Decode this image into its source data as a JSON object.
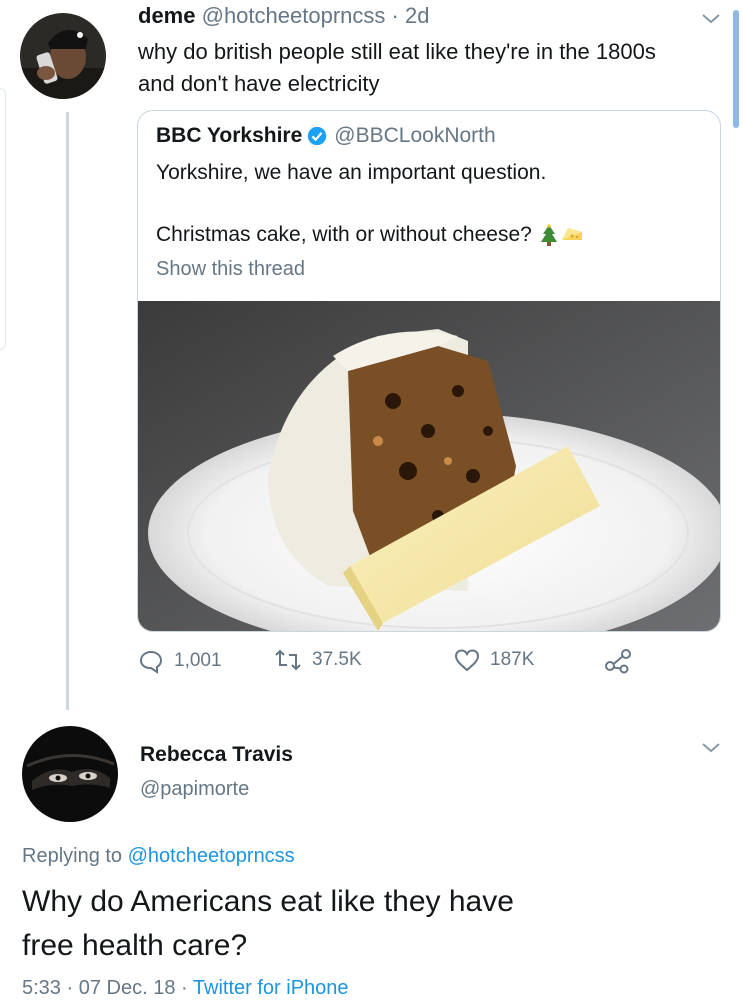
{
  "tweet": {
    "author_name": "deme",
    "author_handle": "@hotcheetoprncss",
    "separator": "·",
    "age": "2d",
    "text_line1": "why do british people still eat like they're in the 1800s",
    "text_line2": "and don't have electricity"
  },
  "quoted_tweet": {
    "author_name": "BBC Yorkshire",
    "author_handle": "@BBCLookNorth",
    "line1": "Yorkshire, we have an important question.",
    "line2": "Christmas cake, with or without cheese?",
    "emoji_1": "christmas-tree-icon",
    "emoji_2": "cheese-icon",
    "show_thread": "Show this thread",
    "image_alt": "christmas-cake-with-cheese-photo"
  },
  "actions": {
    "replies": "1,001",
    "retweets": "37.5K",
    "likes": "187K"
  },
  "reply": {
    "author_name": "Rebecca Travis",
    "author_handle": "@papimorte",
    "replying_prefix": "Replying to",
    "replying_handle": "@hotcheetoprncss",
    "text_line1": "Why do Americans eat like they have",
    "text_line2": "free health care?",
    "time": "5:33",
    "date": "07 Dec. 18",
    "source": "Twitter for iPhone"
  },
  "colors": {
    "link": "#1b95e0",
    "muted": "#657786",
    "verified": "#1da1f2"
  }
}
